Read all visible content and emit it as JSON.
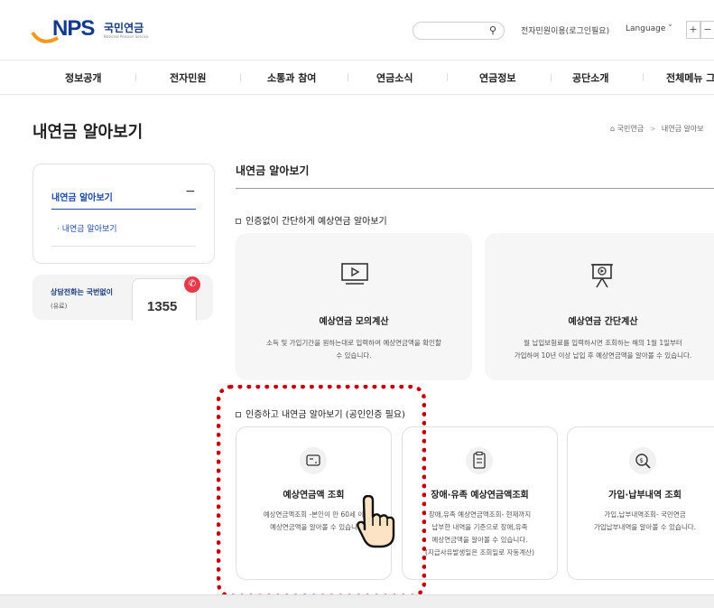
{
  "header": {
    "logo_text": "NPS",
    "logo_kr": "국민연금",
    "logo_sub": "National Pension Service",
    "search_placeholder": "",
    "e_civil": "전자민원이용(로그인필요)",
    "language": "Language",
    "zoom_in": "+",
    "zoom_out": "−"
  },
  "gnb": [
    "정보공개",
    "전자민원",
    "소통과 참여",
    "연금소식",
    "연금정보",
    "공단소개",
    "전체메뉴 그"
  ],
  "page": {
    "title": "내연금 알아보기",
    "breadcrumb_home": "국민연금",
    "breadcrumb_sep": ">",
    "breadcrumb_current": "내연금 알아보"
  },
  "lnb": {
    "title": "내연금 알아보기",
    "toggle": "−",
    "sub_item": "· 내연금 알아보기"
  },
  "call": {
    "line1": "상담전화는 국번없이",
    "line2": "(유료)",
    "number": "1355"
  },
  "main": {
    "section_title": "내연금 알아보기",
    "group1_title": "인증없이 간단하게 예상연금 알아보기",
    "group2_title": "인증하고 내연금 알아보기 (공인인증 필요)",
    "cards1": [
      {
        "title": "예상연금 모의계산",
        "desc": "소득 및 가입기간을 원하는대로 입력하여 예상연금액을 확인할\n수 있습니다.",
        "icon": "monitor-play-icon"
      },
      {
        "title": "예상연금 간단계산",
        "desc": "월 납입보험료를 입력하시면 조회하는 해의 1월 1일부터\n가입하여 10년 이상 납입 후 예상연금액을 알아볼 수 있습니다.",
        "icon": "presentation-icon"
      }
    ],
    "cards2": [
      {
        "title": "예상연금액 조회",
        "desc": "예상연금액조회 -본인이 만 60세 이\n예상연금액을 알아볼 수 있습니",
        "icon": "card-icon"
      },
      {
        "title": "장애·유족 예상연금액조회",
        "desc": "장애,유족 예상연금액조회- 현재까지\n납부한 내역을 기준으로 장애,유족\n예상연금액을 알아볼 수 있습니다.\n(지급사유발생일은 조회일로 자동계산)",
        "icon": "clipboard-icon"
      },
      {
        "title": "가입·납부내역 조회",
        "desc": "가입,납부내역조회- 국민연금\n가입납부내역을 알아볼 수 있습니다.",
        "icon": "search-coin-icon"
      }
    ]
  },
  "colors": {
    "accent": "#1f49a8",
    "annotation": "#c4000c"
  }
}
